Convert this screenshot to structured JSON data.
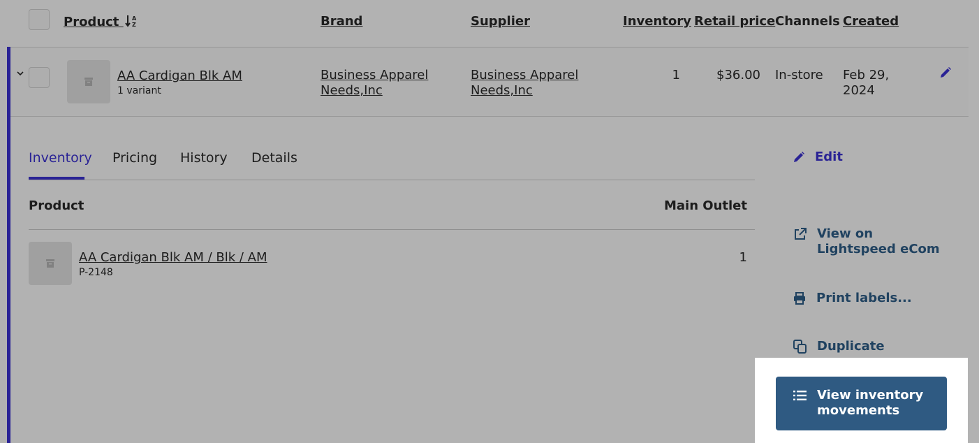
{
  "table_header": {
    "product": "Product",
    "brand": "Brand",
    "supplier": "Supplier",
    "inventory": "Inventory",
    "retail_price": "Retail price",
    "channels": "Channels",
    "created": "Created"
  },
  "product_row": {
    "name": "AA Cardigan Blk AM",
    "variants": "1 variant",
    "brand_line1": "Business Apparel",
    "brand_line2": "Needs,Inc",
    "supplier_line1": "Business Apparel",
    "supplier_line2": "Needs,Inc",
    "inventory": "1",
    "retail_price": "$36.00",
    "channels": "In-store",
    "created_line1": "Feb 29,",
    "created_line2": "2024"
  },
  "tabs": [
    {
      "label": "Inventory",
      "active": true
    },
    {
      "label": "Pricing"
    },
    {
      "label": "History"
    },
    {
      "label": "Details"
    }
  ],
  "inventory_table": {
    "col_product": "Product",
    "col_outlet": "Main Outlet",
    "rows": [
      {
        "name": "AA Cardigan Blk AM / Blk / AM",
        "sku": "P-2148",
        "qty": "1"
      }
    ]
  },
  "actions": {
    "edit": "Edit",
    "view_on_line1": "View on",
    "view_on_line2": "Lightspeed eCom",
    "print_labels": "Print labels...",
    "duplicate": "Duplicate",
    "view_movements_line1": "View inventory",
    "view_movements_line2": "movements"
  },
  "colors": {
    "accent": "#3d33d6",
    "action_text": "#2f5f8a",
    "primary_button": "#2f5a82",
    "overlay": "rgba(0,0,0,0.30)"
  }
}
